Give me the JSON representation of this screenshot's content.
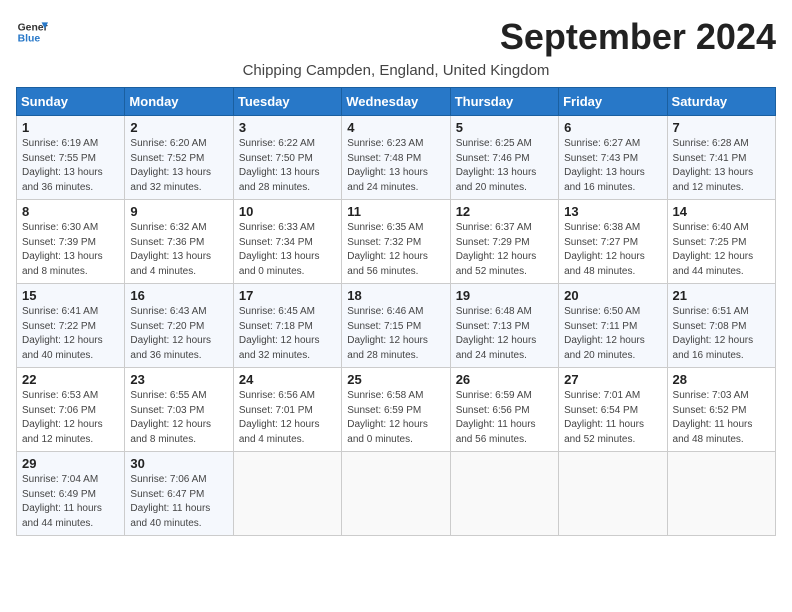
{
  "logo": {
    "line1": "General",
    "line2": "Blue"
  },
  "title": "September 2024",
  "subtitle": "Chipping Campden, England, United Kingdom",
  "days_of_week": [
    "Sunday",
    "Monday",
    "Tuesday",
    "Wednesday",
    "Thursday",
    "Friday",
    "Saturday"
  ],
  "weeks": [
    [
      {
        "day": 1,
        "rise": "6:19 AM",
        "set": "7:55 PM",
        "daylight": "13 hours and 36 minutes."
      },
      {
        "day": 2,
        "rise": "6:20 AM",
        "set": "7:52 PM",
        "daylight": "13 hours and 32 minutes."
      },
      {
        "day": 3,
        "rise": "6:22 AM",
        "set": "7:50 PM",
        "daylight": "13 hours and 28 minutes."
      },
      {
        "day": 4,
        "rise": "6:23 AM",
        "set": "7:48 PM",
        "daylight": "13 hours and 24 minutes."
      },
      {
        "day": 5,
        "rise": "6:25 AM",
        "set": "7:46 PM",
        "daylight": "13 hours and 20 minutes."
      },
      {
        "day": 6,
        "rise": "6:27 AM",
        "set": "7:43 PM",
        "daylight": "13 hours and 16 minutes."
      },
      {
        "day": 7,
        "rise": "6:28 AM",
        "set": "7:41 PM",
        "daylight": "13 hours and 12 minutes."
      }
    ],
    [
      {
        "day": 8,
        "rise": "6:30 AM",
        "set": "7:39 PM",
        "daylight": "13 hours and 8 minutes."
      },
      {
        "day": 9,
        "rise": "6:32 AM",
        "set": "7:36 PM",
        "daylight": "13 hours and 4 minutes."
      },
      {
        "day": 10,
        "rise": "6:33 AM",
        "set": "7:34 PM",
        "daylight": "13 hours and 0 minutes."
      },
      {
        "day": 11,
        "rise": "6:35 AM",
        "set": "7:32 PM",
        "daylight": "12 hours and 56 minutes."
      },
      {
        "day": 12,
        "rise": "6:37 AM",
        "set": "7:29 PM",
        "daylight": "12 hours and 52 minutes."
      },
      {
        "day": 13,
        "rise": "6:38 AM",
        "set": "7:27 PM",
        "daylight": "12 hours and 48 minutes."
      },
      {
        "day": 14,
        "rise": "6:40 AM",
        "set": "7:25 PM",
        "daylight": "12 hours and 44 minutes."
      }
    ],
    [
      {
        "day": 15,
        "rise": "6:41 AM",
        "set": "7:22 PM",
        "daylight": "12 hours and 40 minutes."
      },
      {
        "day": 16,
        "rise": "6:43 AM",
        "set": "7:20 PM",
        "daylight": "12 hours and 36 minutes."
      },
      {
        "day": 17,
        "rise": "6:45 AM",
        "set": "7:18 PM",
        "daylight": "12 hours and 32 minutes."
      },
      {
        "day": 18,
        "rise": "6:46 AM",
        "set": "7:15 PM",
        "daylight": "12 hours and 28 minutes."
      },
      {
        "day": 19,
        "rise": "6:48 AM",
        "set": "7:13 PM",
        "daylight": "12 hours and 24 minutes."
      },
      {
        "day": 20,
        "rise": "6:50 AM",
        "set": "7:11 PM",
        "daylight": "12 hours and 20 minutes."
      },
      {
        "day": 21,
        "rise": "6:51 AM",
        "set": "7:08 PM",
        "daylight": "12 hours and 16 minutes."
      }
    ],
    [
      {
        "day": 22,
        "rise": "6:53 AM",
        "set": "7:06 PM",
        "daylight": "12 hours and 12 minutes."
      },
      {
        "day": 23,
        "rise": "6:55 AM",
        "set": "7:03 PM",
        "daylight": "12 hours and 8 minutes."
      },
      {
        "day": 24,
        "rise": "6:56 AM",
        "set": "7:01 PM",
        "daylight": "12 hours and 4 minutes."
      },
      {
        "day": 25,
        "rise": "6:58 AM",
        "set": "6:59 PM",
        "daylight": "12 hours and 0 minutes."
      },
      {
        "day": 26,
        "rise": "6:59 AM",
        "set": "6:56 PM",
        "daylight": "11 hours and 56 minutes."
      },
      {
        "day": 27,
        "rise": "7:01 AM",
        "set": "6:54 PM",
        "daylight": "11 hours and 52 minutes."
      },
      {
        "day": 28,
        "rise": "7:03 AM",
        "set": "6:52 PM",
        "daylight": "11 hours and 48 minutes."
      }
    ],
    [
      {
        "day": 29,
        "rise": "7:04 AM",
        "set": "6:49 PM",
        "daylight": "11 hours and 44 minutes."
      },
      {
        "day": 30,
        "rise": "7:06 AM",
        "set": "6:47 PM",
        "daylight": "11 hours and 40 minutes."
      },
      null,
      null,
      null,
      null,
      null
    ]
  ]
}
